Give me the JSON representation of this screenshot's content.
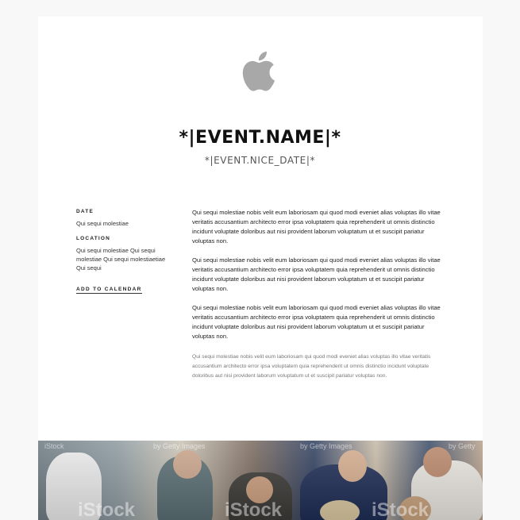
{
  "header": {
    "logo_icon": "apple-logo-icon",
    "logo_color": "#a8a8a8",
    "title": "*|EVENT.NAME|*",
    "subtitle": "*|EVENT.NICE_DATE|*"
  },
  "sidebar": {
    "date_label": "DATE",
    "date_value": "Qui sequi molestiae",
    "location_label": "LOCATION",
    "location_value": "Qui sequi molestiae Qui sequi molestiae Qui sequi molestiaetiae Qui sequi",
    "add_to_calendar": "ADD TO CALENDAR"
  },
  "content": {
    "paragraphs": [
      "Qui sequi molestiae nobis velit eum laboriosam qui quod modi eveniet alias voluptas illo vitae veritatis accusantium architecto error ipsa voluptatem quia reprehenderit ut omnis distinctio incidunt voluptate doloribus aut nisi provident laborum voluptatum ut et suscipit pariatur voluptas non.",
      "Qui sequi molestiae nobis velit eum laboriosam qui quod modi eveniet alias voluptas illo vitae veritatis accusantium architecto error ipsa voluptatem quia reprehenderit ut omnis distinctio incidunt voluptate doloribus aut nisi provident laborum voluptatum ut et suscipit pariatur voluptas non.",
      "Qui sequi molestiae nobis velit eum laboriosam qui quod modi eveniet alias voluptas illo vitae veritatis accusantium architecto error ipsa voluptatem quia reprehenderit ut omnis distinctio incidunt voluptate doloribus aut nisi provident laborum voluptatum ut et suscipit pariatur voluptas non."
    ],
    "small_paragraph": "Qui sequi molestiae nobis velit eum laboriosam qui quod modi eveniet alias voluptas illo vitae veritatis accusantium architecto error ipsa voluptatem quia reprehenderit ut omnis distinctio incidunt voluptate doloribus aut nisi provident laborum voluptatum ut et suscipit pariatur voluptas non."
  },
  "photo": {
    "watermark_small": [
      "iStock",
      "by Getty Images",
      "by Getty Images",
      "by Getty"
    ],
    "watermark_big": [
      "iStock",
      "iStock",
      "iStock"
    ]
  }
}
